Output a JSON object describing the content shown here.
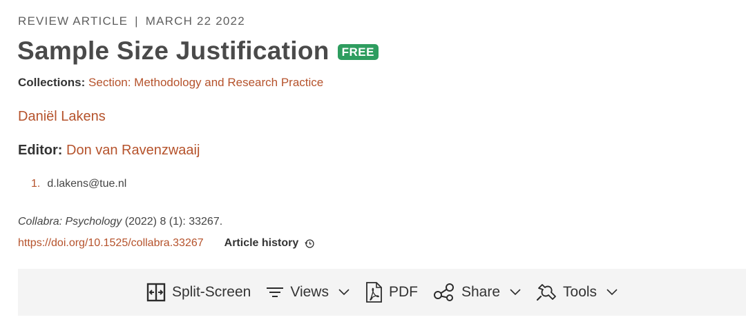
{
  "article": {
    "type": "REVIEW ARTICLE",
    "separator": "|",
    "date": "MARCH 22 2022",
    "title": "Sample Size Justification",
    "badge": "FREE",
    "collections_label": "Collections:",
    "collections_link": "Section: Methodology and Research Practice",
    "author": "Daniël Lakens",
    "editor_label": "Editor:",
    "editor_name": "Don van Ravenzwaaij",
    "affiliation_number": "1.",
    "affiliation_email": "d.lakens@tue.nl",
    "journal": "Collabra: Psychology",
    "citation_rest": " (2022) 8 (1): 33267.",
    "doi": "https://doi.org/10.1525/collabra.33267",
    "history_label": "Article history"
  },
  "toolbar": {
    "split_screen": "Split-Screen",
    "views": "Views",
    "pdf": "PDF",
    "share": "Share",
    "tools": "Tools"
  },
  "colors": {
    "link": "#b5522b",
    "badge": "#2e9d5f",
    "toolbar_bg": "#f4f4f4"
  },
  "icons": [
    "split-screen-icon",
    "views-icon",
    "pdf-icon",
    "share-icon",
    "tools-icon",
    "chevron-down-icon",
    "history-icon"
  ]
}
